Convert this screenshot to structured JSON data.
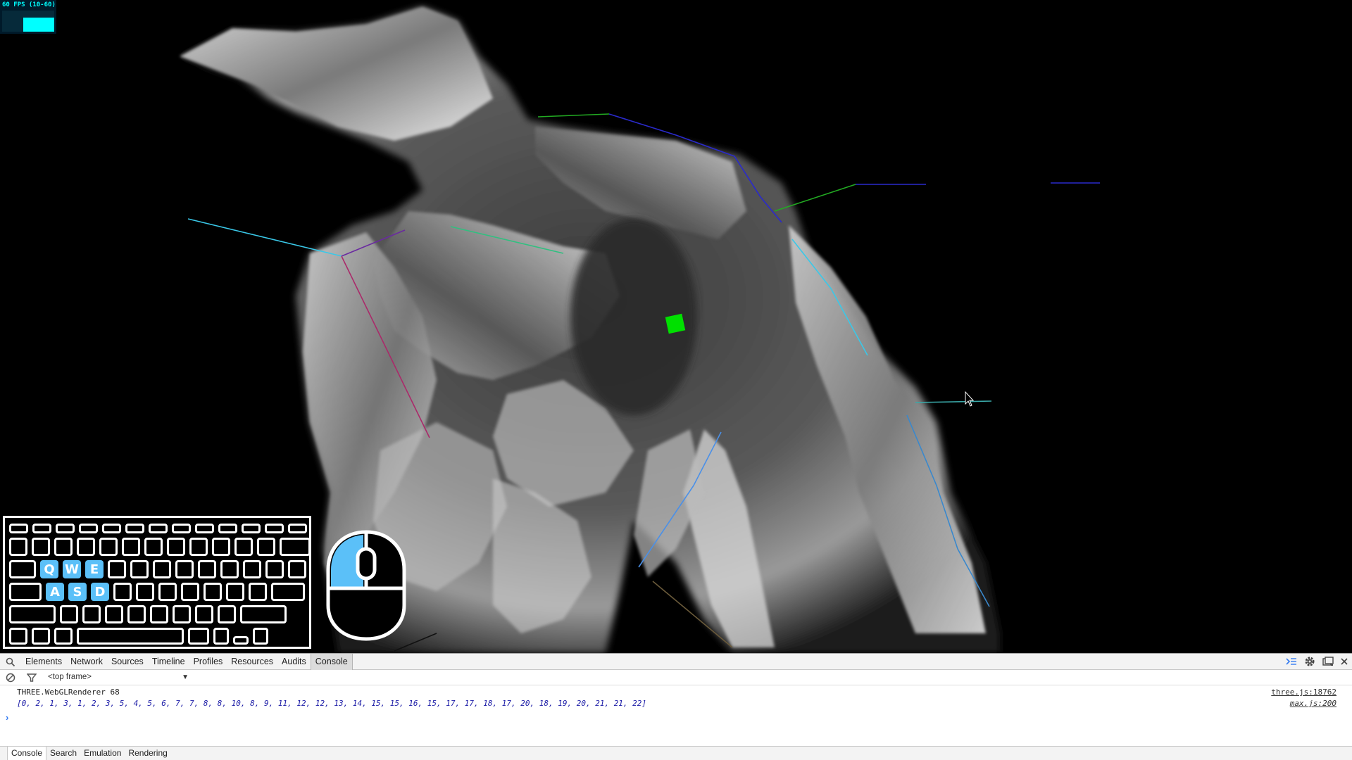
{
  "stats": {
    "fps_text": "60 FPS (10-60)"
  },
  "keyboard": {
    "active_color": "#5bc0f8",
    "rows": [
      [
        "",
        "",
        "",
        "",
        "",
        "",
        "",
        "",
        "",
        "",
        "",
        "",
        ""
      ],
      [
        "",
        "",
        "",
        "",
        "",
        "",
        "",
        "",
        "",
        "",
        "",
        "",
        ""
      ],
      [
        "",
        "Q",
        "W",
        "E",
        "",
        "",
        "",
        "",
        "",
        "",
        "",
        "",
        ""
      ],
      [
        "",
        "A",
        "S",
        "D",
        "",
        "",
        "",
        "",
        "",
        "",
        "",
        ""
      ],
      [
        "",
        "",
        "",
        "",
        "",
        "",
        "",
        "",
        "",
        "",
        ""
      ],
      [
        "",
        "",
        "",
        "",
        "",
        "",
        "",
        ""
      ]
    ],
    "active_keys": [
      "Q",
      "W",
      "E",
      "A",
      "S",
      "D"
    ]
  },
  "mouse": {
    "active_button": "left"
  },
  "scene": {
    "marker_color": "#00e000",
    "description_colors": [
      "#2a2acc",
      "#22aa22",
      "#3ac8e8",
      "#6a2aa0",
      "#aa2a6a",
      "#3a88cc"
    ]
  },
  "devtools": {
    "tabs": [
      "Elements",
      "Network",
      "Sources",
      "Timeline",
      "Profiles",
      "Resources",
      "Audits",
      "Console"
    ],
    "active_tab": "Console",
    "frame_select": "<top frame>",
    "messages": [
      {
        "text": "THREE.WebGLRenderer 68",
        "source": "three.js:18762",
        "kind": "log"
      },
      {
        "text": "[0, 2, 1, 3, 1, 2, 3, 5, 4, 5, 6, 7, 7, 8, 8, 10, 8, 9, 11, 12, 12, 13, 14, 15, 15, 16, 15, 17, 17, 18, 17, 20, 18, 19, 20, 21, 21, 22]",
        "source": "max.js:200",
        "kind": "arr"
      }
    ],
    "prompt": "›",
    "drawer_tabs": [
      "Console",
      "Search",
      "Emulation",
      "Rendering"
    ],
    "drawer_active": "Console"
  }
}
